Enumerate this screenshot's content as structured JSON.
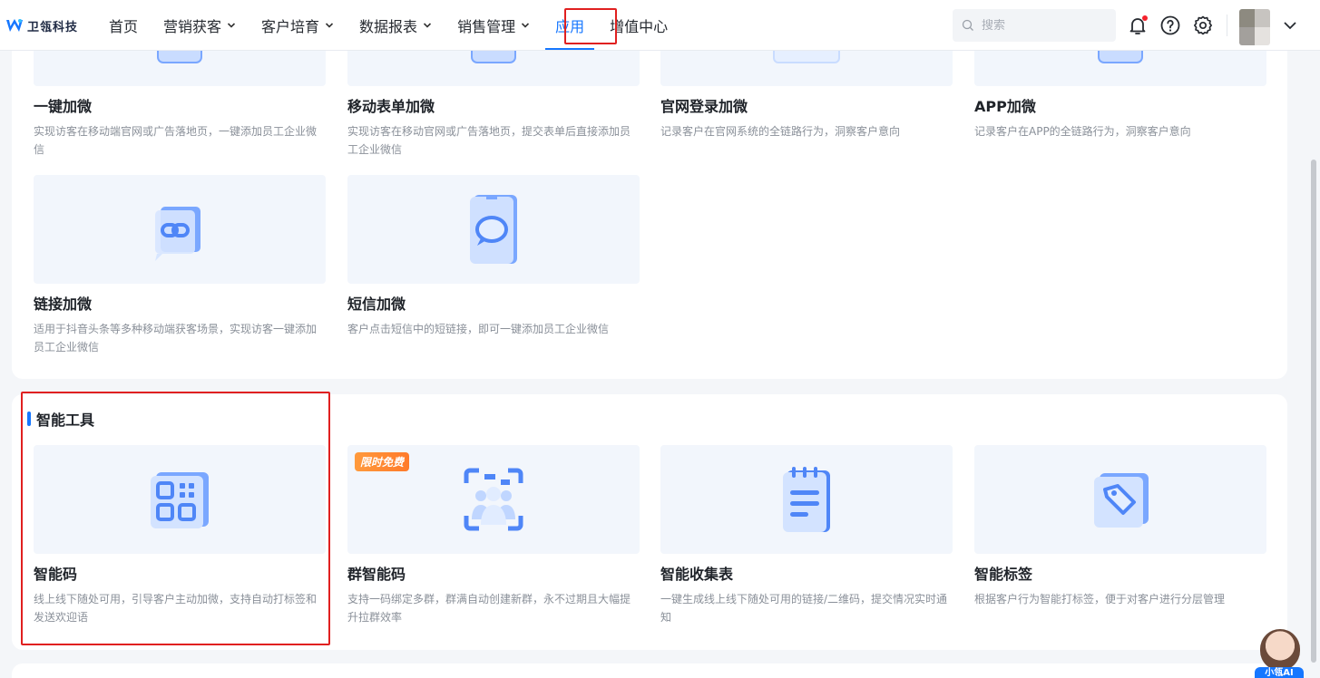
{
  "brand": {
    "name": "卫瓴科技"
  },
  "nav": {
    "items": [
      {
        "label": "首页",
        "has_dropdown": false
      },
      {
        "label": "营销获客",
        "has_dropdown": true
      },
      {
        "label": "客户培育",
        "has_dropdown": true
      },
      {
        "label": "数据报表",
        "has_dropdown": true
      },
      {
        "label": "销售管理",
        "has_dropdown": true
      },
      {
        "label": "应用",
        "has_dropdown": false,
        "active": true
      },
      {
        "label": "增值中心",
        "has_dropdown": false
      }
    ]
  },
  "search": {
    "placeholder": "搜索"
  },
  "header_icons": [
    "bell-icon",
    "help-icon",
    "gear-icon",
    "chevron-down-icon"
  ],
  "colors": {
    "accent": "#1677ff",
    "highlight": "#e02020",
    "badge": "#ff8a30"
  },
  "wechat_section": {
    "cards": [
      {
        "title": "一键加微",
        "desc": "实现访客在移动端官网或广告落地页，一键添加员工企业微信"
      },
      {
        "title": "移动表单加微",
        "desc": "实现访客在移动官网或广告落地页，提交表单后直接添加员工企业微信"
      },
      {
        "title": "官网登录加微",
        "desc": "记录客户在官网系统的全链路行为，洞察客户意向"
      },
      {
        "title": "APP加微",
        "desc": "记录客户在APP的全链路行为，洞察客户意向"
      },
      {
        "title": "链接加微",
        "desc": "适用于抖音头条等多种移动端获客场景，实现访客一键添加员工企业微信"
      },
      {
        "title": "短信加微",
        "desc": "客户点击短信中的短链接，即可一键添加员工企业微信"
      }
    ]
  },
  "tools_section": {
    "title": "智能工具",
    "cards": [
      {
        "title": "智能码",
        "desc": "线上线下随处可用，引导客户主动加微，支持自动打标签和发送欢迎语",
        "icon": "qr-code-icon"
      },
      {
        "title": "群智能码",
        "desc": "支持一码绑定多群，群满自动创建新群，永不过期且大幅提升拉群效率",
        "icon": "group-qr-icon",
        "badge": "限时免费"
      },
      {
        "title": "智能收集表",
        "desc": "一键生成线上线下随处可用的链接/二维码，提交情况实时通知",
        "icon": "notepad-icon"
      },
      {
        "title": "智能标签",
        "desc": "根据客户行为智能打标签，便于对客户进行分层管理",
        "icon": "tag-icon"
      }
    ]
  },
  "assistant": {
    "label": "小瓴AI"
  }
}
